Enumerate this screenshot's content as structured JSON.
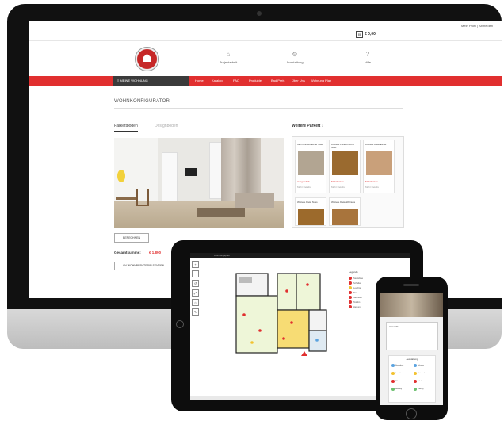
{
  "monitor": {
    "top_links": "Mein Profil  |  Abmelden",
    "cart_icon": "cart-icon",
    "cart_price": "€ 0,00",
    "header_nav": [
      {
        "label": "Projektarbeit",
        "icon": "home-icon"
      },
      {
        "label": "Ausstattung",
        "icon": "settings-icon"
      },
      {
        "label": "Hilfe",
        "icon": "help-icon"
      }
    ],
    "redbar": {
      "current": "≡  MEINE WOHNUNG",
      "items": [
        "Home",
        "Katalog",
        "FAQ",
        "Produkte",
        "Bad Preis",
        "Über Uns",
        "Wohnung Plan"
      ]
    },
    "page_title": "WOHNKONFIGURATOR",
    "tabs": [
      "Parkettboden",
      "Designböden"
    ],
    "choice_title": "Weitere Parkett ↓",
    "parkett_cards": [
      {
        "name": "Mein Parkett Eiche Natur",
        "color": "#b2a592",
        "price": "Ausgewählt",
        "link": "Mehr Details"
      },
      {
        "name": "Weitere Parkett Eiche Gold",
        "color": "#9a6a2f",
        "price": "Mehrkosten",
        "link": "Mehr Details"
      },
      {
        "name": "Weitere Diele Eiche",
        "color": "#c9a07a",
        "price": "Mehrkosten",
        "link": "Mehr Details"
      },
      {
        "name": "Weitere Diele Nuss",
        "color": "#9c6a2c",
        "price": "",
        "link": ""
      },
      {
        "name": "Weitere Diele Walnuss",
        "color": "#a8743c",
        "price": "",
        "link": ""
      }
    ],
    "btn_berechnen": "BERECHNEN",
    "total_label": "Gesamtsumme:",
    "total_value": "€ 1.890",
    "btn_send": "AN WOHNBERATERIN SENDEN"
  },
  "tablet": {
    "status_text": "Wohnungsplan",
    "legend_title": "Legende",
    "legend_items": [
      {
        "label": "Steckdose",
        "color": "#e12f2f"
      },
      {
        "label": "Schalter",
        "color": "#e12f2f"
      },
      {
        "label": "Leuchte",
        "color": "#f2c230"
      },
      {
        "label": "TV",
        "color": "#e12f2f"
      },
      {
        "label": "Netzwerk",
        "color": "#e12f2f"
      },
      {
        "label": "Telefon",
        "color": "#e12f2f"
      },
      {
        "label": "Heizung",
        "color": "#e12f2f"
      }
    ],
    "sidebar_tools": [
      "+",
      "−",
      "↺",
      "⤢",
      "⌂",
      "✎"
    ]
  },
  "phone": {
    "modal_title": "Auswahl",
    "list_title": "Ausstattung",
    "list_items": [
      {
        "label": "Steckdose",
        "color": "#5ba3e0"
      },
      {
        "label": "Schalter",
        "color": "#5ba3e0"
      },
      {
        "label": "Leuchte",
        "color": "#f2c230"
      },
      {
        "label": "Netzwerk",
        "color": "#f2c230"
      },
      {
        "label": "TV",
        "color": "#e12f2f"
      },
      {
        "label": "Telefon",
        "color": "#e12f2f"
      },
      {
        "label": "Heizung",
        "color": "#6cc070"
      },
      {
        "label": "Lüftung",
        "color": "#6cc070"
      }
    ]
  }
}
